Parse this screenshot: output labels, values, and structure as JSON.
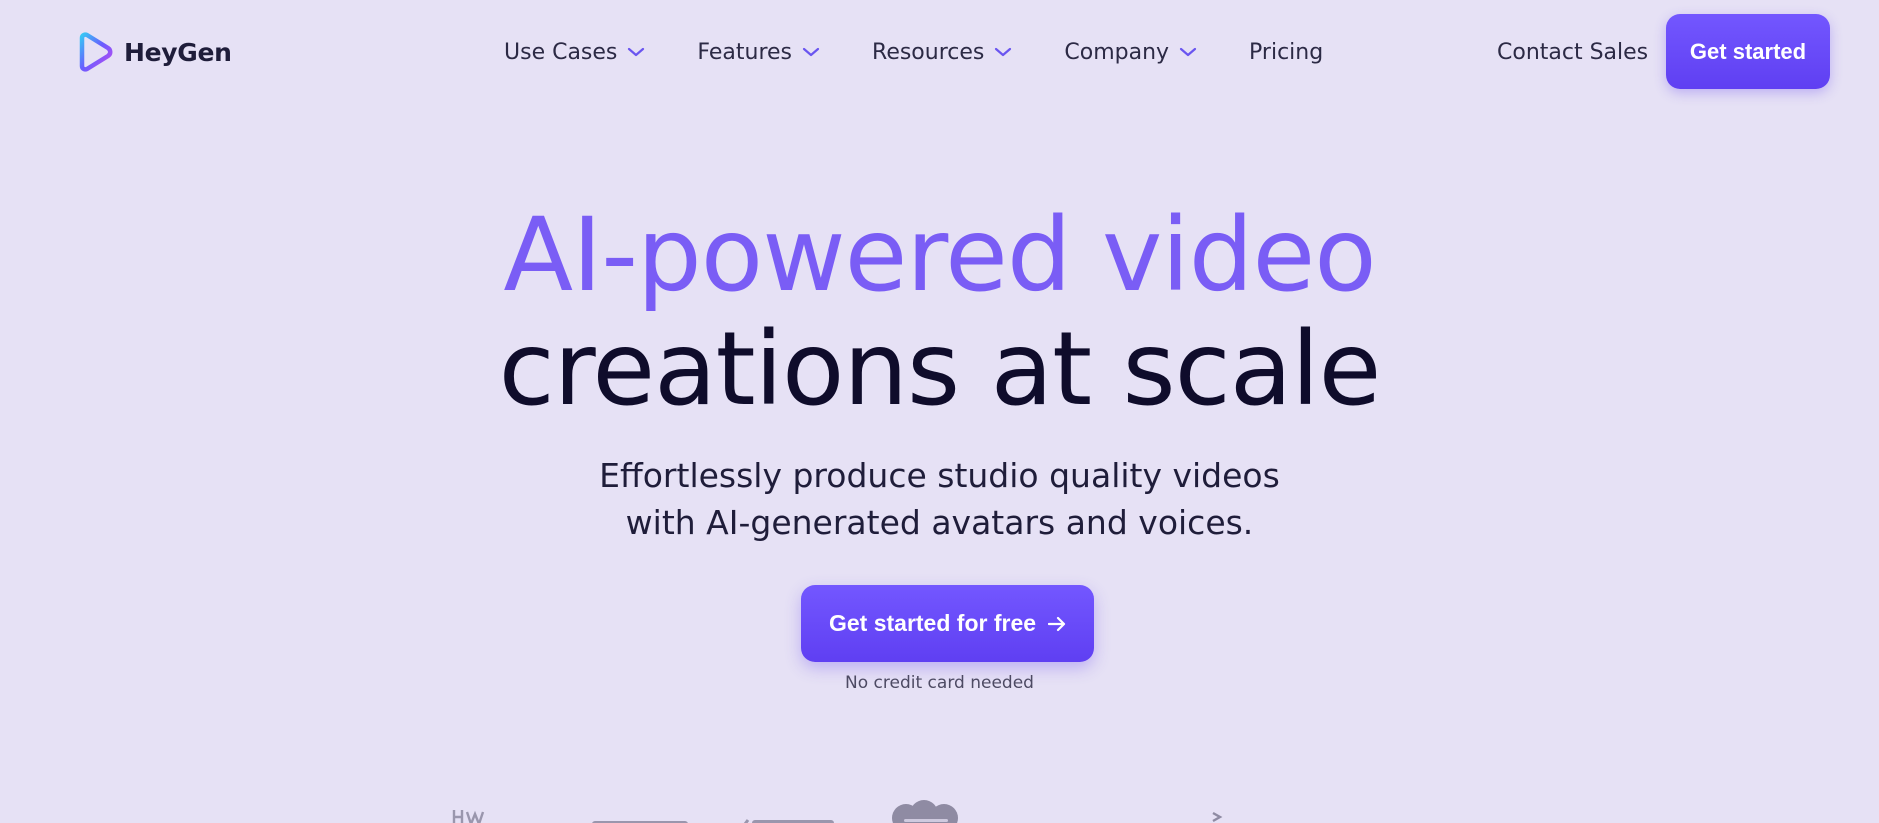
{
  "brand": {
    "name": "HeyGen",
    "accent": "#7357ff",
    "icon": "heygen-logo-icon"
  },
  "nav": {
    "items": [
      {
        "label": "Use Cases",
        "has_dropdown": true
      },
      {
        "label": "Features",
        "has_dropdown": true
      },
      {
        "label": "Resources",
        "has_dropdown": true
      },
      {
        "label": "Company",
        "has_dropdown": true
      },
      {
        "label": "Pricing",
        "has_dropdown": false
      }
    ],
    "contact_label": "Contact Sales",
    "cta_label": "Get started"
  },
  "hero": {
    "headline_line1": "AI-powered video",
    "headline_line2": "creations at scale",
    "sub_line1": "Effortlessly produce studio quality videos",
    "sub_line2": "with AI-generated avatars and voices.",
    "cta_label": "Get started for free",
    "cta_icon": "arrow-right-icon",
    "note": "No credit card needed"
  },
  "colors": {
    "background": "#e6e1f5",
    "headline_accent": "#7a5df5",
    "headline_dark": "#0f0c2b",
    "button_gradient_top": "#7357ff",
    "button_gradient_bottom": "#5f3ff2"
  }
}
